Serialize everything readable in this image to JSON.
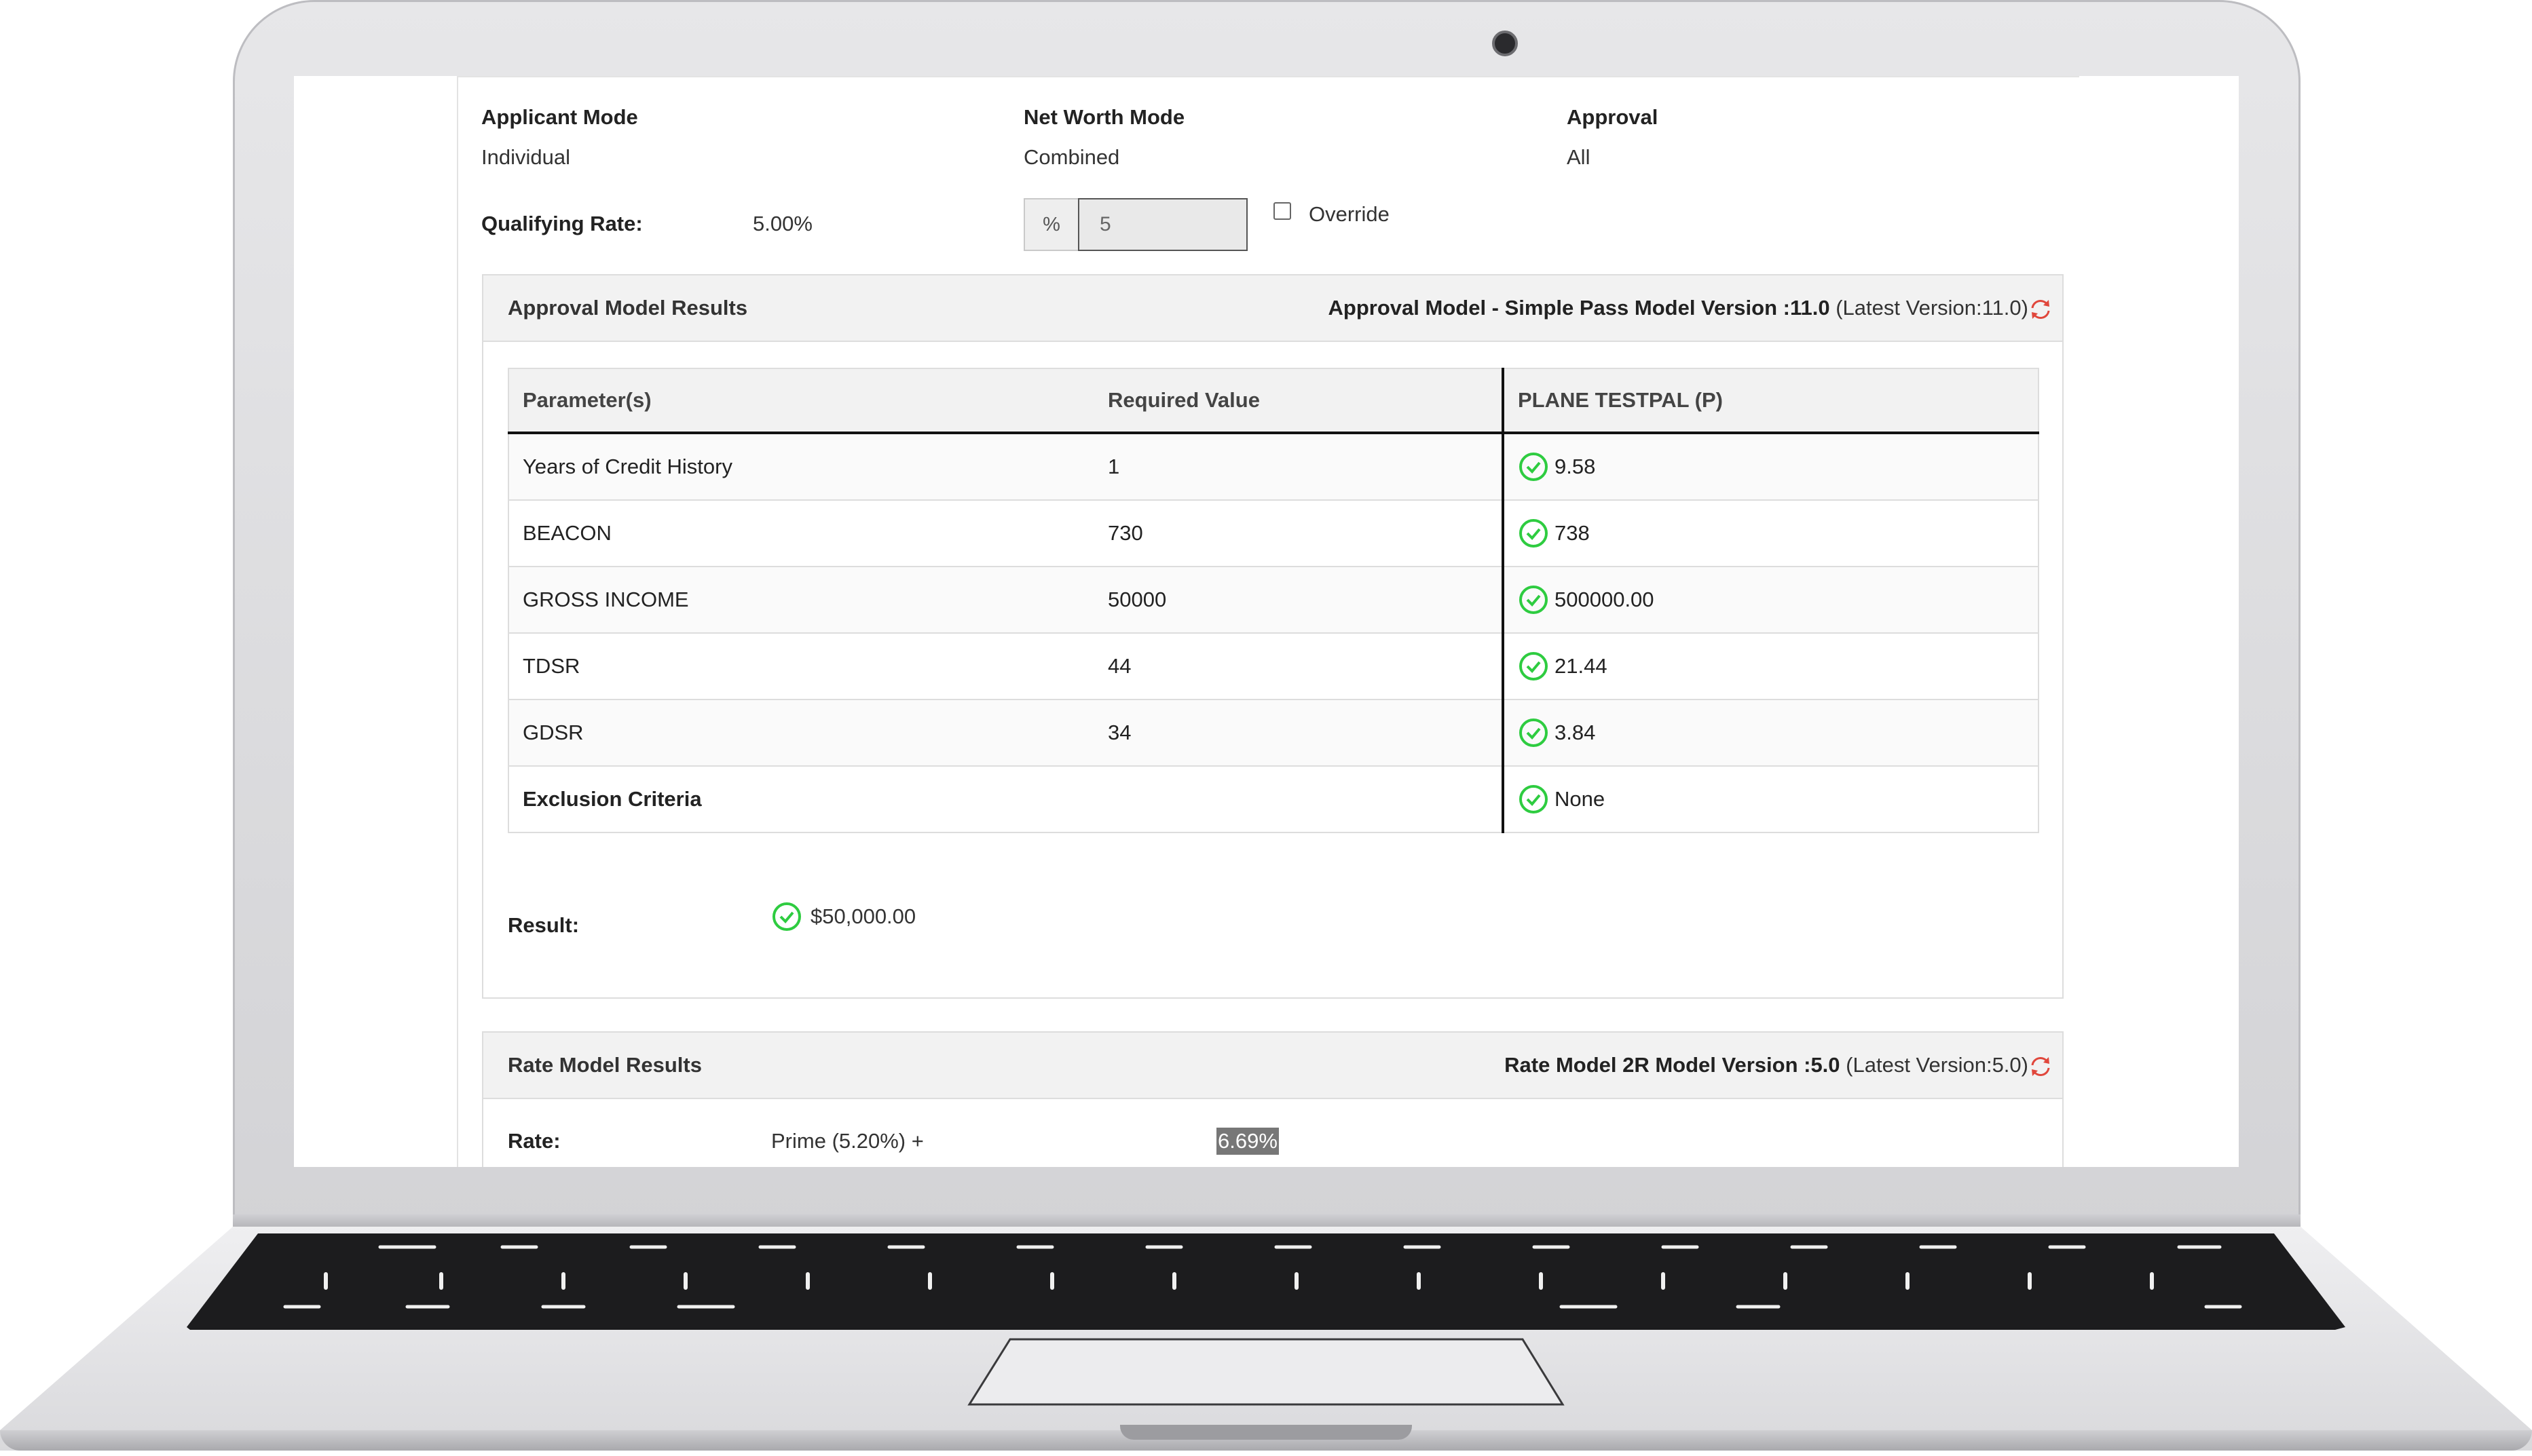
{
  "header": {
    "applicant_mode_label": "Applicant Mode",
    "applicant_mode_value": "Individual",
    "net_worth_mode_label": "Net Worth Mode",
    "net_worth_mode_value": "Combined",
    "approval_label": "Approval",
    "approval_value": "All"
  },
  "qualifying": {
    "label": "Qualifying Rate:",
    "value": "5.00%",
    "addon": "%",
    "input_value": "5",
    "override_label": "Override",
    "override_checked": false
  },
  "approval_panel": {
    "title": "Approval Model Results",
    "model_name": "Approval Model - Simple Pass Model Version :11.0",
    "latest_version": "(Latest Version:11.0)",
    "columns": [
      "Parameter(s)",
      "Required Value",
      "PLANE TESTPAL (P)"
    ],
    "rows": [
      {
        "param": "Years of Credit History",
        "required": "1",
        "value": "9.58"
      },
      {
        "param": "BEACON",
        "required": "730",
        "value": "738"
      },
      {
        "param": "GROSS INCOME",
        "required": "50000",
        "value": "500000.00"
      },
      {
        "param": "TDSR",
        "required": "44",
        "value": "21.44"
      },
      {
        "param": "GDSR",
        "required": "34",
        "value": "3.84"
      },
      {
        "param": "Exclusion Criteria",
        "required": "",
        "value": "None"
      }
    ],
    "result_label": "Result:",
    "result_value": "$50,000.00"
  },
  "rate_panel": {
    "title": "Rate Model Results",
    "model_name": "Rate Model 2R Model Version :5.0",
    "latest_version": "(Latest Version:5.0)",
    "rate_label": "Rate:",
    "rate_formula": "Prime (5.20%) +",
    "rate_value": "6.69%"
  },
  "colors": {
    "check_green": "#2ecc40",
    "refresh_red": "#e0473c",
    "panel_header": "#f2f2f2"
  },
  "icons": {
    "check": "check-circle-icon",
    "refresh": "refresh-icon",
    "camera": "camera-icon"
  }
}
